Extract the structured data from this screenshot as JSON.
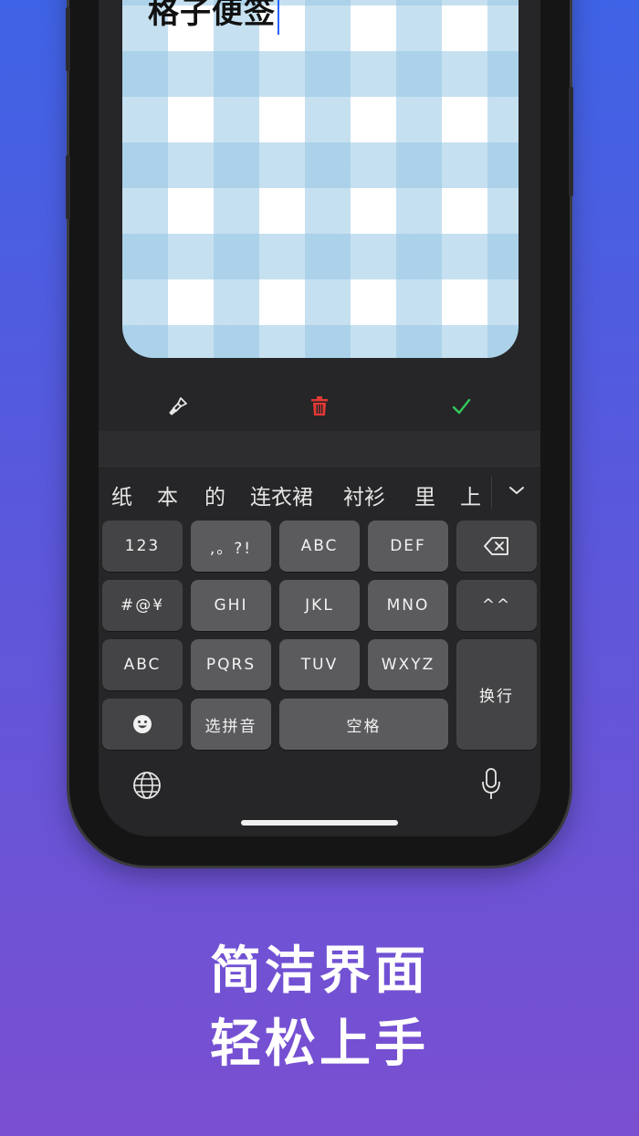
{
  "note": {
    "title": "格子便签"
  },
  "toolbar": {
    "brush_icon": "paintbrush-icon",
    "trash_icon": "trash-icon",
    "check_icon": "checkmark-icon",
    "trash_color": "#e53935",
    "check_color": "#34c759"
  },
  "keyboard": {
    "candidates": [
      "纸",
      "本",
      "的",
      "连衣裙",
      "衬衫",
      "里",
      "上"
    ],
    "keys": {
      "num": "123",
      "punct": ",。?!",
      "abc_key": "ABC",
      "def_key": "DEF",
      "symbols": "#@¥",
      "ghi": "GHI",
      "jkl": "JKL",
      "mno": "MNO",
      "emoticon": "^^",
      "abc_mode": "ABC",
      "pqrs": "PQRS",
      "tuv": "TUV",
      "wxyz": "WXYZ",
      "enter": "换行",
      "pinyin": "选拼音",
      "space": "空格"
    }
  },
  "headline": {
    "line1": "简洁界面",
    "line2": "轻松上手"
  }
}
